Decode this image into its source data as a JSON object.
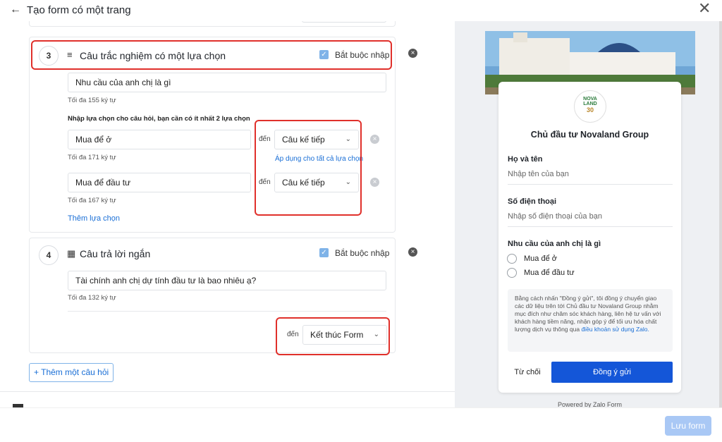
{
  "header": {
    "back_icon": "arrow-left-icon",
    "title": "Tạo form có một trang",
    "close_icon": "close-icon"
  },
  "question3": {
    "number": "3",
    "title": "Câu trắc nghiệm có một lựa chọn",
    "required_label": "Bắt buộc nhập",
    "question_value": "Nhu cầu của anh chị là gì",
    "question_hint": "Tối đa 155 ký tự",
    "options_instruction": "Nhập lựa chọn cho câu hỏi, bạn cần có ít nhất 2 lựa chọn",
    "options": [
      {
        "value": "Mua để ở",
        "hint": "Tối đa 171 ký tự",
        "goto_label": "đến",
        "goto_value": "Câu kế tiếp"
      },
      {
        "value": "Mua để đầu tư",
        "hint": "Tối đa 167 ký tự",
        "goto_label": "đến",
        "goto_value": "Câu kế tiếp"
      }
    ],
    "apply_all_link": "Áp dụng cho tất cả lựa chọn",
    "add_option_link": "Thêm lựa chọn"
  },
  "question4": {
    "number": "4",
    "title": "Câu trả lời ngắn",
    "required_label": "Bắt buộc nhập",
    "question_value": "Tài chính anh chị dự tính đầu tư là bao nhiêu ạ?",
    "question_hint": "Tối đa 132 ký tự",
    "goto_label": "đến",
    "goto_value": "Kết thúc Form"
  },
  "add_question_label": "Thêm một câu hỏi",
  "preview": {
    "logo_text_top": "NOVA",
    "logo_text_mid": "LAND",
    "logo_text_num": "30",
    "form_title": "Chủ đầu tư Novaland Group",
    "fields": [
      {
        "label": "Họ và tên",
        "placeholder": "Nhập tên của bạn"
      },
      {
        "label": "Số điện thoại",
        "placeholder": "Nhập số điện thoại của bạn"
      }
    ],
    "choice_question": "Nhu cầu của anh chị là gì",
    "choices": [
      "Mua để ở",
      "Mua để đầu tư"
    ],
    "consent_text": "Bằng cách nhấn \"Đồng ý gửi\", tôi đồng ý chuyển giao các dữ liệu trên tới Chủ đầu tư Novaland Group nhằm mục đích như chăm sóc khách hàng, liên hệ tư vấn với khách hàng tiềm năng, nhận góp ý để tối ưu hóa chất lượng dịch vụ thông qua",
    "consent_link": "điều khoản sử dụng Zalo.",
    "reject_label": "Từ chối",
    "agree_label": "Đồng ý gửi",
    "powered_by": "Powered by Zalo Form"
  },
  "footer": {
    "save_label": "Lưu form"
  },
  "colors": {
    "accent": "#1456d8",
    "highlight": "#e0302b",
    "link": "#1a6fd6"
  }
}
